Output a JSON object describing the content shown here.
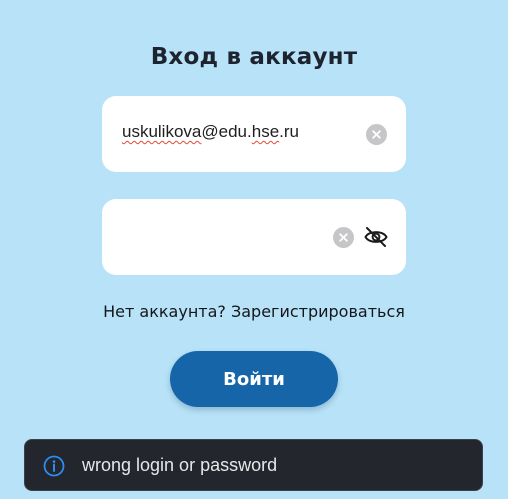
{
  "header": {
    "title": "Вход в аккаунт"
  },
  "login_form": {
    "email": {
      "value": "uskulikova@edu.hse.ru",
      "parts": [
        "uskulikova",
        "@edu.",
        "hse",
        ".ru"
      ]
    },
    "password": {
      "value": ""
    },
    "register_link": "Нет аккаунта? Зарегистрироваться",
    "submit_label": "Войти"
  },
  "icons": {
    "clear": "clear-icon",
    "visibility": "eye-off-icon",
    "info": "info-icon"
  },
  "toast": {
    "message": "wrong login or password"
  },
  "colors": {
    "background": "#b7e2f7",
    "accent": "#1565a8",
    "toast_background": "#23262c",
    "info_icon": "#2d8cf0"
  }
}
